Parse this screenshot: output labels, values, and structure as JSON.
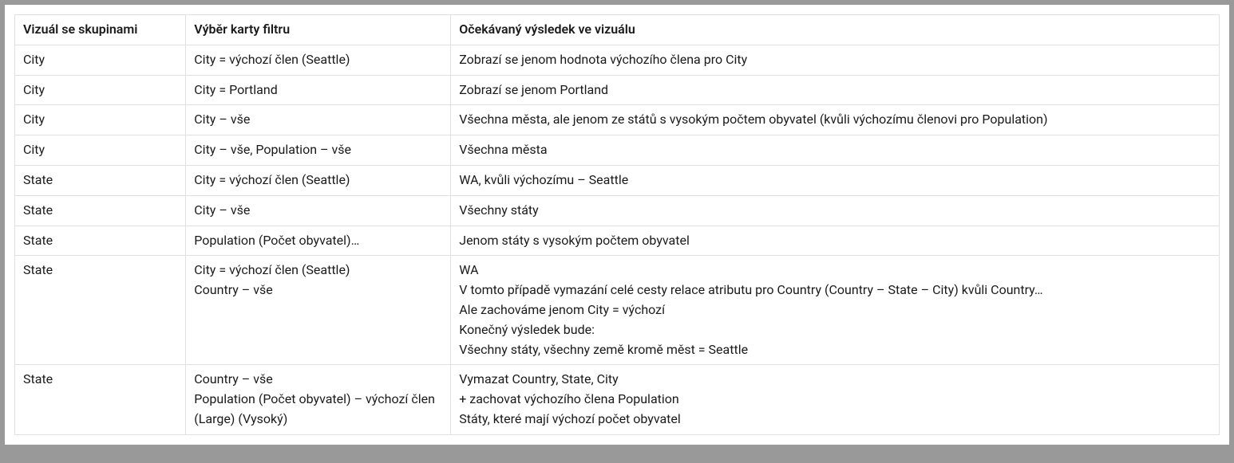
{
  "table": {
    "headers": {
      "col1": "Vizuál se skupinami",
      "col2": "Výběr karty filtru",
      "col3": "Očekávaný výsledek ve vizuálu"
    },
    "rows": [
      {
        "visual": "City",
        "filter": [
          "City = výchozí člen (Seattle)"
        ],
        "result": [
          "Zobrazí se jenom hodnota výchozího člena pro City"
        ]
      },
      {
        "visual": "City",
        "filter": [
          "City = Portland"
        ],
        "result": [
          "Zobrazí se jenom Portland"
        ]
      },
      {
        "visual": "City",
        "filter": [
          "City – vše"
        ],
        "result": [
          "Všechna města, ale jenom ze států s vysokým počtem obyvatel (kvůli výchozímu členovi pro Population)"
        ]
      },
      {
        "visual": "City",
        "filter": [
          "City – vše, Population – vše"
        ],
        "result": [
          "Všechna města"
        ]
      },
      {
        "visual": "State",
        "filter": [
          "City = výchozí člen (Seattle)"
        ],
        "result": [
          "WA, kvůli výchozímu – Seattle"
        ]
      },
      {
        "visual": "State",
        "filter": [
          "City – vše"
        ],
        "result": [
          "Všechny státy"
        ]
      },
      {
        "visual": "State",
        "filter": [
          "Population (Počet obyvatel)…"
        ],
        "result": [
          "Jenom státy s vysokým počtem obyvatel"
        ]
      },
      {
        "visual": "State",
        "filter": [
          "City = výchozí člen (Seattle)",
          "Country – vše"
        ],
        "result": [
          "WA",
          "V tomto případě vymazání celé cesty relace atributu pro Country (Country – State – City) kvůli Country…",
          "Ale zachováme jenom City = výchozí",
          "Konečný výsledek bude:",
          "Všechny státy, všechny země kromě měst = Seattle"
        ]
      },
      {
        "visual": "State",
        "filter": [
          "Country – vše",
          "Population (Počet obyvatel) – výchozí člen (Large) (Vysoký)"
        ],
        "result": [
          "Vymazat Country, State, City",
          "+ zachovat výchozího člena Population",
          "Státy, které mají výchozí počet obyvatel"
        ]
      }
    ]
  }
}
